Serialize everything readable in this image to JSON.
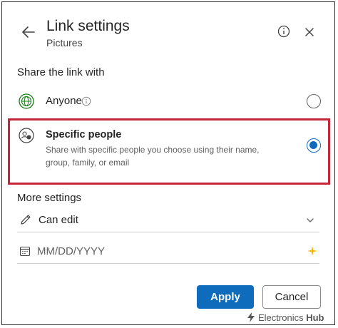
{
  "header": {
    "title": "Link settings",
    "subtitle": "Pictures",
    "back_icon": "arrow-left-icon",
    "info_icon": "info-icon",
    "close_icon": "close-icon"
  },
  "share_section": {
    "heading": "Share the link with",
    "options": [
      {
        "label": "Anyone",
        "icon": "globe-icon",
        "selected": false
      },
      {
        "label": "Specific people",
        "description": "Share with specific people you choose using their name, group, family, or email",
        "icon": "people-icon",
        "selected": true
      }
    ]
  },
  "more_settings": {
    "heading": "More settings",
    "permission": {
      "value": "Can edit",
      "icon": "pencil-icon"
    },
    "expiry": {
      "placeholder": "MM/DD/YYYY",
      "value": "",
      "icon": "calendar-icon"
    }
  },
  "footer": {
    "apply_label": "Apply",
    "cancel_label": "Cancel"
  },
  "watermark": {
    "brand": "Electronics",
    "suffix": "Hub"
  },
  "colors": {
    "accent": "#0f6cbd",
    "highlight_border": "#c5273a",
    "text_primary": "#242424",
    "text_secondary": "#616161",
    "sparkle": "#f2b705"
  }
}
